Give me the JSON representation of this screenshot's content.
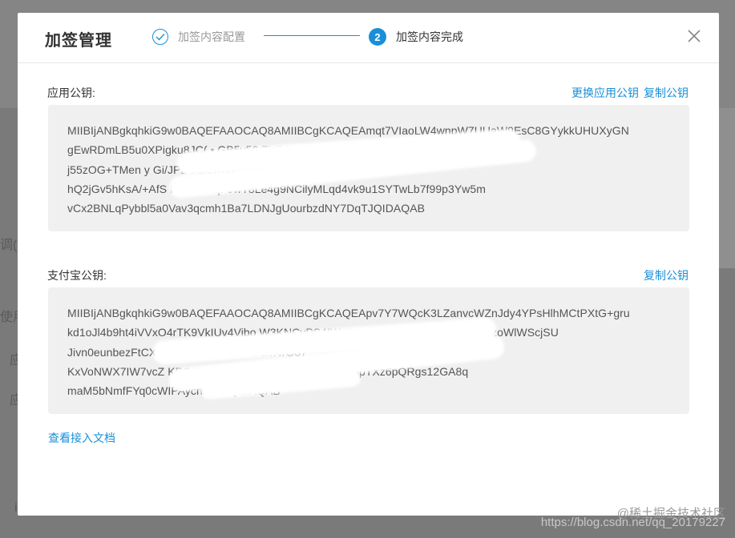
{
  "background": {
    "fragment_1": "调(指",
    "fragment_2": "使用",
    "fragment_3": "应",
    "fragment_4": "应",
    "fragment_5": "i"
  },
  "modal": {
    "title": "加签管理",
    "steps": [
      {
        "label": "加签内容配置",
        "state": "done",
        "icon": "check-icon"
      },
      {
        "number": "2",
        "label": "加签内容完成",
        "state": "active"
      }
    ],
    "close_icon": "close-icon"
  },
  "app_key": {
    "label": "应用公钥:",
    "links": [
      "更换应用公钥",
      "复制公钥"
    ],
    "lines": [
      "MIIBIjANBgkqhkiG9w0BAQEFAAOCAQ8AMIIBCgKCAQEAmqt7VIaoLW4wnpW7UUaW9EsC8GYykkUHUXyGN",
      "gEwRDmLB5u0XPigku8JC(             •           GB5v50        7ieik3LB9FZdZUtL",
      "j55zOG+TMen                                      y  Gi/JPDUSk/R0obnVdB5OR",
      "hQ2jGv5hKsA/+AfS           NwZhkstqF9wT8Le4g9NCilyMLqd4vk9u1SYTwLb7f99p3Yw5m",
      "vCx2BNLqPybbl5a0Vav3qcmh1Ba7LDNJgUourbzdNY7DqTJQIDAQAB"
    ]
  },
  "alipay_key": {
    "label": "支付宝公钥:",
    "links": [
      "复制公钥"
    ],
    "lines": [
      "MIIBIjANBgkqhkiG9w0BAQEFAAOCAQ8AMIIBCgKCAQEApv7Y7WQcK3LZanvcWZnJdy4YPsHlhMCtPXtG+gru",
      "kd1oJl4b9ht4iVVxO4rTK9VkIUv4Vibo            W3KNCvPS4IW+AK+2x6u7  AdCSx8GI5NAAazoWlWScjSU",
      "Jivn0eunbezFtCX                                                   qpQRvHL7HTWiYOom4rOo7",
      "KxVoNWX7IW7vcZ               KPQ2MNc0A22Ta01k123AIiTHV4LR8pTXz6pQRgs12GA8q",
      "maM5bNmfFYq0cWIPAycnm            xDQIDAQAB"
    ]
  },
  "doc_link": "查看接入文档",
  "watermark": {
    "site": "@稀土掘金技术社区",
    "url": "https://blog.csdn.net/qq_20179227"
  },
  "colors": {
    "accent": "#1a8fd8",
    "overlay": "#7a7a7a",
    "key_box": "#f0f0f0"
  }
}
